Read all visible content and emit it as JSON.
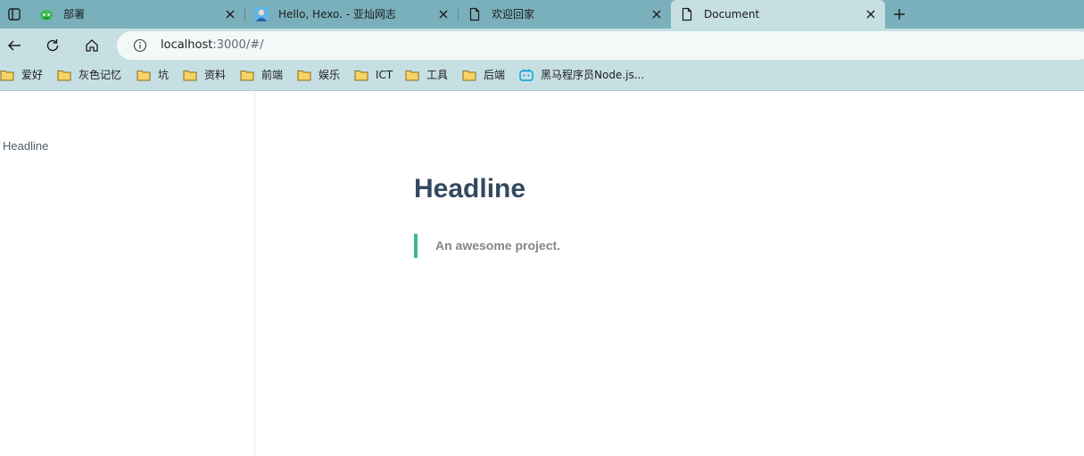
{
  "tabs": [
    {
      "title": "部署",
      "favicon": "green-mascot-icon",
      "active": false
    },
    {
      "title": "Hello, Hexo. - 亚灿网志",
      "favicon": "avatar-icon",
      "active": false
    },
    {
      "title": "欢迎回家",
      "favicon": "document-icon",
      "active": false
    },
    {
      "title": "Document",
      "favicon": "document-icon",
      "active": true
    }
  ],
  "address_bar": {
    "host": "localhost",
    "rest": ":3000/#/"
  },
  "bookmarks": [
    {
      "label": "爱好",
      "icon": "folder-icon"
    },
    {
      "label": "灰色记忆",
      "icon": "folder-icon"
    },
    {
      "label": "坑",
      "icon": "folder-icon"
    },
    {
      "label": "资料",
      "icon": "folder-icon"
    },
    {
      "label": "前端",
      "icon": "folder-icon"
    },
    {
      "label": "娱乐",
      "icon": "folder-icon"
    },
    {
      "label": "ICT",
      "icon": "folder-icon"
    },
    {
      "label": "工具",
      "icon": "folder-icon"
    },
    {
      "label": "后端",
      "icon": "folder-icon"
    },
    {
      "label": "黑马程序员Node.js...",
      "icon": "bilibili-icon"
    }
  ],
  "sidebar": {
    "items": [
      {
        "label": "Headline"
      }
    ]
  },
  "main": {
    "title": "Headline",
    "blockquote": "An awesome project."
  },
  "colors": {
    "tabstrip": "#7ab0bb",
    "toolbar": "#c6dfe3",
    "accent": "#42b983",
    "heading": "#34495e"
  }
}
